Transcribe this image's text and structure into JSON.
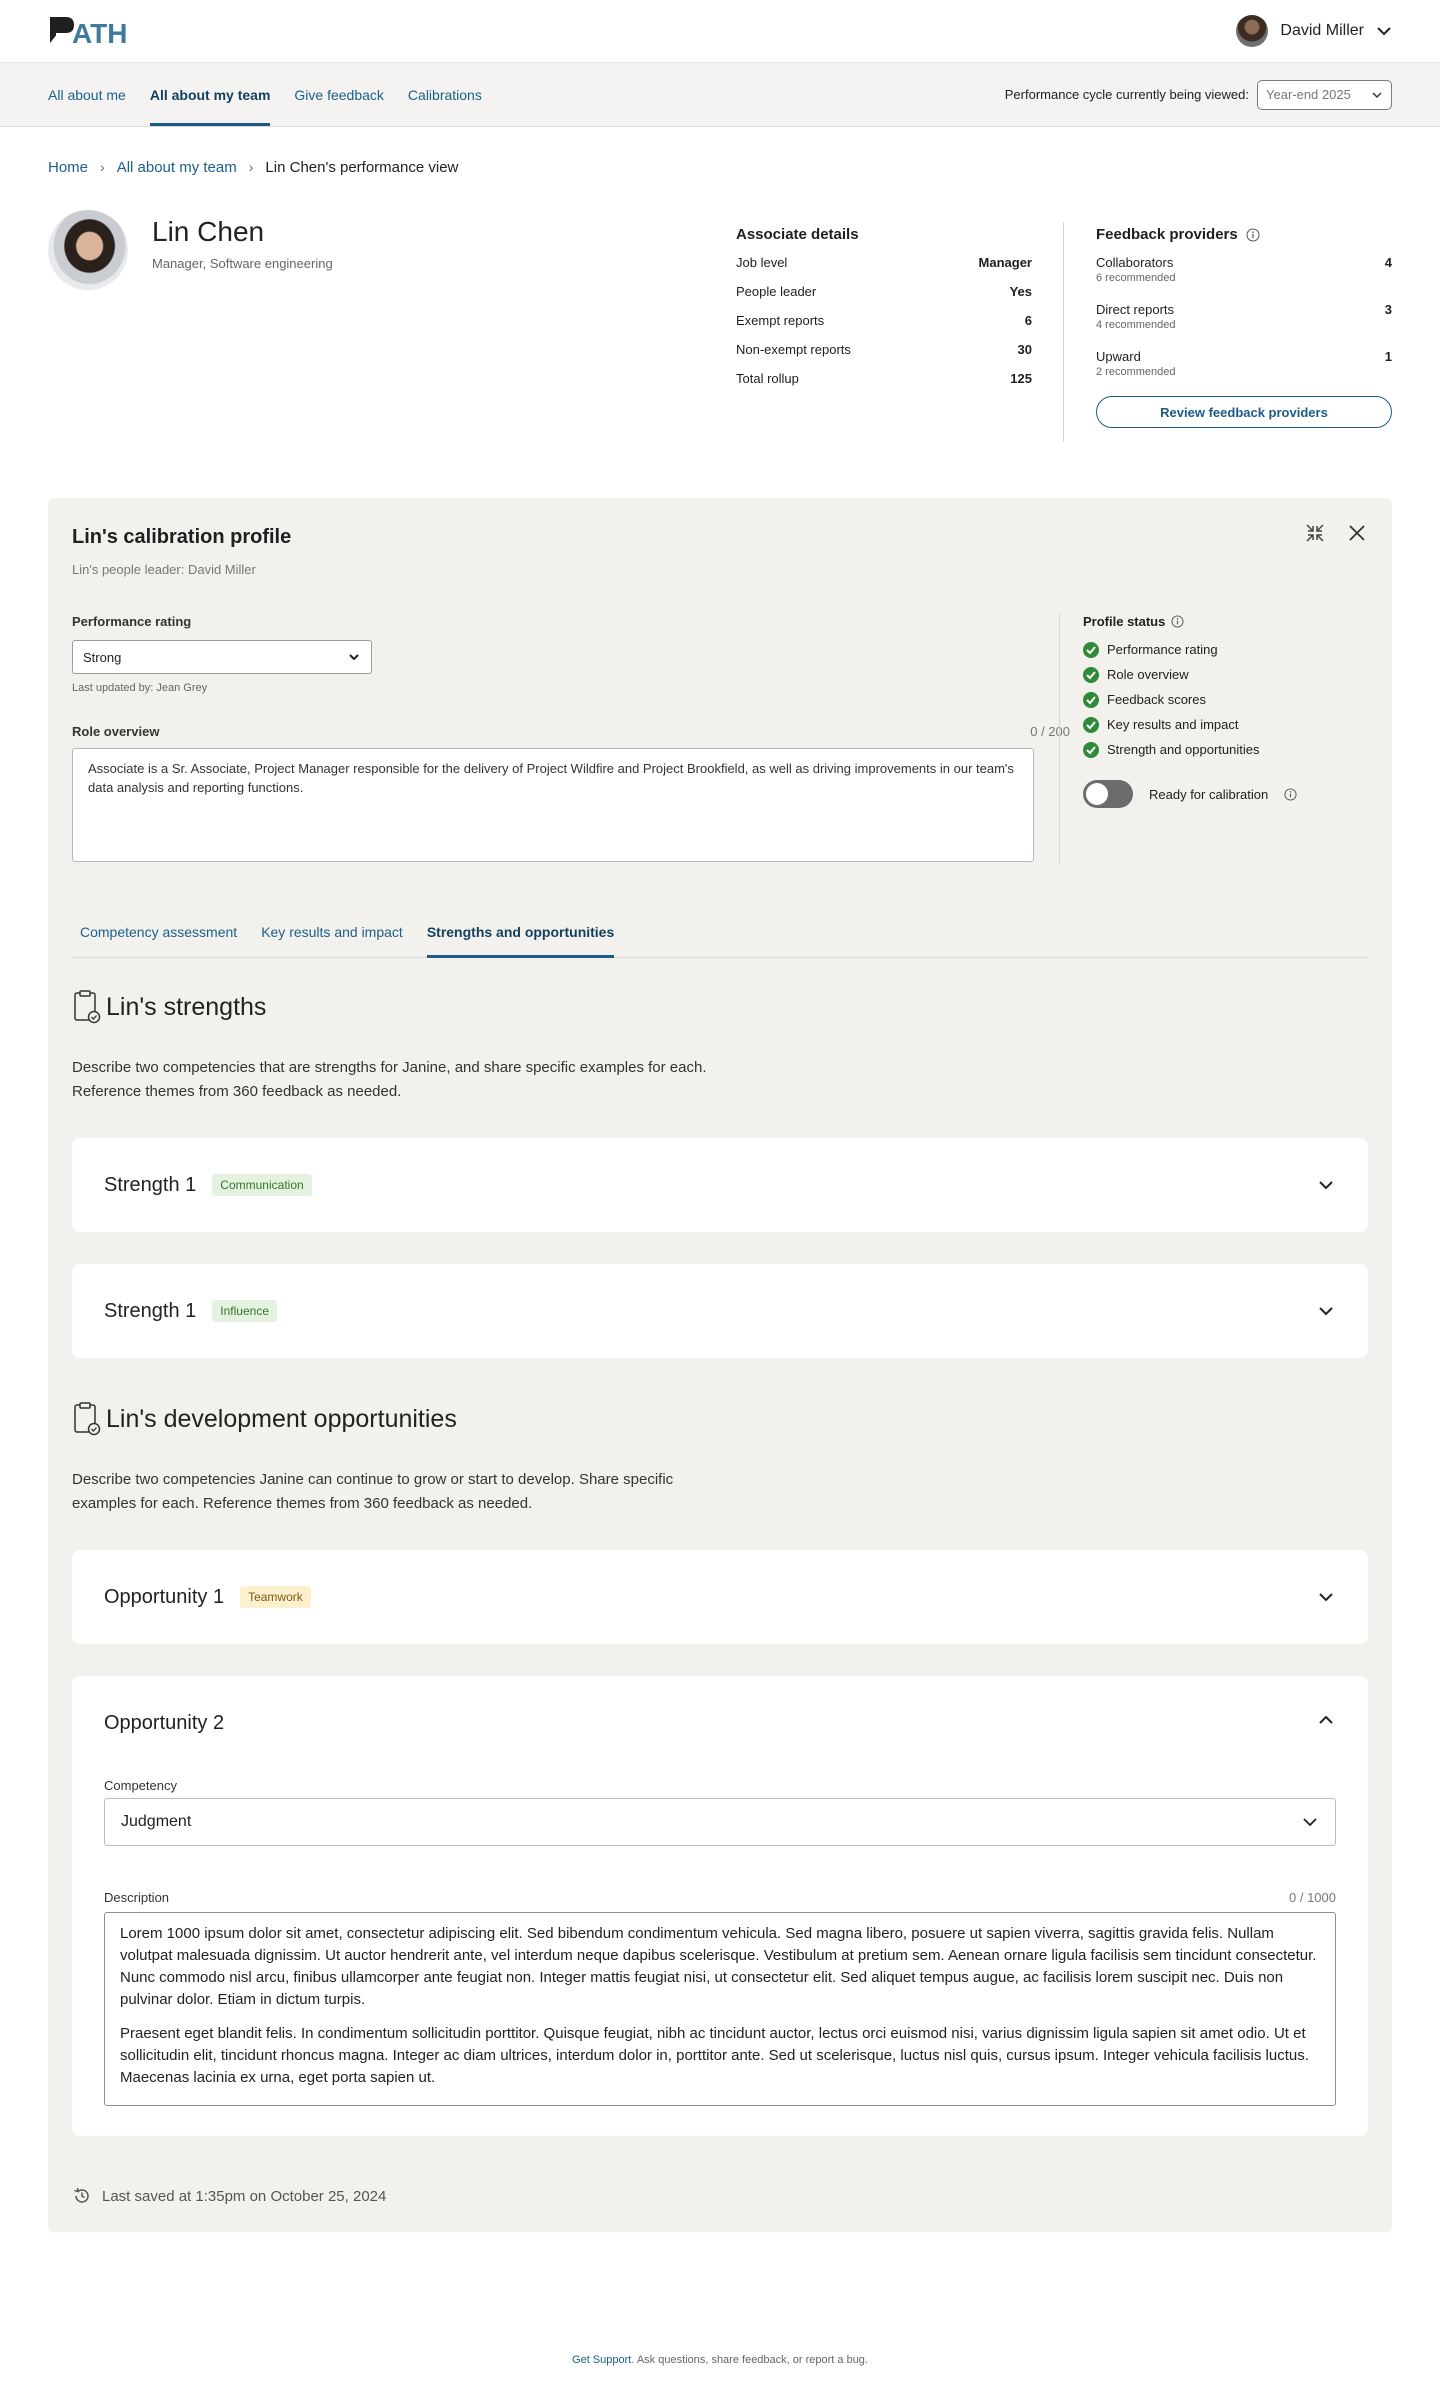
{
  "header": {
    "logo_text": "PATH",
    "user_name": "David Miller"
  },
  "nav": {
    "tabs": [
      {
        "label": "All about me"
      },
      {
        "label": "All about my team"
      },
      {
        "label": "Give feedback"
      },
      {
        "label": "Calibrations"
      }
    ],
    "active_tab": "All about my team",
    "cycle_label": "Performance cycle currently being viewed:",
    "cycle_value": "Year-end 2025"
  },
  "breadcrumb": {
    "home": "Home",
    "team": "All about my team",
    "current": "Lin Chen's performance view"
  },
  "profile": {
    "name": "Lin Chen",
    "title": "Manager, Software engineering"
  },
  "associate_details": {
    "heading": "Associate details",
    "rows": [
      {
        "label": "Job level",
        "value": "Manager"
      },
      {
        "label": "People leader",
        "value": "Yes"
      },
      {
        "label": "Exempt reports",
        "value": "6"
      },
      {
        "label": "Non-exempt reports",
        "value": "30"
      },
      {
        "label": "Total rollup",
        "value": "125"
      }
    ]
  },
  "feedback_providers": {
    "heading": "Feedback providers",
    "items": [
      {
        "label": "Collaborators",
        "sub": "6 recommended",
        "value": "4"
      },
      {
        "label": "Direct reports",
        "sub": "4 recommended",
        "value": "3"
      },
      {
        "label": "Upward",
        "sub": "2 recommended",
        "value": "1"
      }
    ],
    "button": "Review feedback providers"
  },
  "calibration": {
    "title": "Lin's calibration profile",
    "subtitle": "Lin's people leader: David Miller",
    "performance_label": "Performance rating",
    "performance_value": "Strong",
    "last_updated": "Last updated by: Jean Grey",
    "role_label": "Role overview",
    "role_count": "0 / 200",
    "role_text": "Associate is a Sr. Associate, Project Manager responsible for the delivery of Project Wildfire and Project Brookfield, as well as driving improvements in our team's data analysis and reporting functions.",
    "status_heading": "Profile status",
    "status_items": [
      {
        "label": "Performance rating"
      },
      {
        "label": "Role overview"
      },
      {
        "label": "Feedback scores"
      },
      {
        "label": "Key results and impact"
      },
      {
        "label": "Strength and opportunities"
      }
    ],
    "ready_label": "Ready for calibration",
    "ready_on": false,
    "subtabs": [
      {
        "label": "Competency assessment"
      },
      {
        "label": "Key results and impact"
      },
      {
        "label": "Strengths and opportunities"
      }
    ],
    "active_subtab": "Strengths and opportunities"
  },
  "strengths": {
    "heading": "Lin's strengths",
    "description": "Describe two competencies that are strengths for Janine, and share specific examples for each. Reference themes from 360 feedback as needed.",
    "items": [
      {
        "title": "Strength 1",
        "tag": "Communication"
      },
      {
        "title": "Strength 1",
        "tag": "Influence"
      }
    ]
  },
  "opportunities": {
    "heading": "Lin's development opportunities",
    "description": "Describe two competencies Janine can continue to grow or start to develop. Share specific examples for each. Reference themes from 360 feedback as needed.",
    "item1": {
      "title": "Opportunity 1",
      "tag": "Teamwork"
    },
    "item2": {
      "title": "Opportunity 2",
      "competency_label": "Competency",
      "competency_value": "Judgment",
      "description_label": "Description",
      "description_count": "0 / 1000",
      "paragraph1": "Lorem 1000 ipsum dolor sit amet, consectetur adipiscing elit. Sed bibendum condimentum vehicula. Sed magna libero, posuere ut sapien viverra, sagittis gravida felis. Nullam volutpat malesuada dignissim. Ut auctor hendrerit ante, vel interdum neque dapibus scelerisque. Vestibulum at pretium sem. Aenean ornare ligula facilisis sem tincidunt consectetur. Nunc commodo nisl arcu, finibus ullamcorper ante feugiat non. Integer mattis feugiat nisi, ut consectetur elit. Sed aliquet tempus augue, ac facilisis lorem suscipit nec. Duis non pulvinar dolor. Etiam in dictum turpis.",
      "paragraph2": "Praesent eget blandit felis. In condimentum sollicitudin porttitor. Quisque feugiat, nibh ac tincidunt auctor, lectus orci euismod nisi, varius dignissim ligula sapien sit amet odio. Ut et sollicitudin elit, tincidunt rhoncus magna. Integer ac diam ultrices, interdum dolor in, porttitor ante. Sed ut scelerisque, luctus nisl quis, cursus ipsum. Integer vehicula facilisis luctus. Maecenas lacinia ex urna, eget porta sapien ut."
    }
  },
  "saved": "Last saved at 1:35pm on October 25, 2024",
  "footer": {
    "link": "Get Support",
    "text": ". Ask questions, share feedback, or report a bug."
  },
  "colors": {
    "accent": "#1d5b86",
    "link": "#1b5f8a",
    "panel_bg": "#f3f1ed",
    "check_green": "#2f8a3a"
  }
}
